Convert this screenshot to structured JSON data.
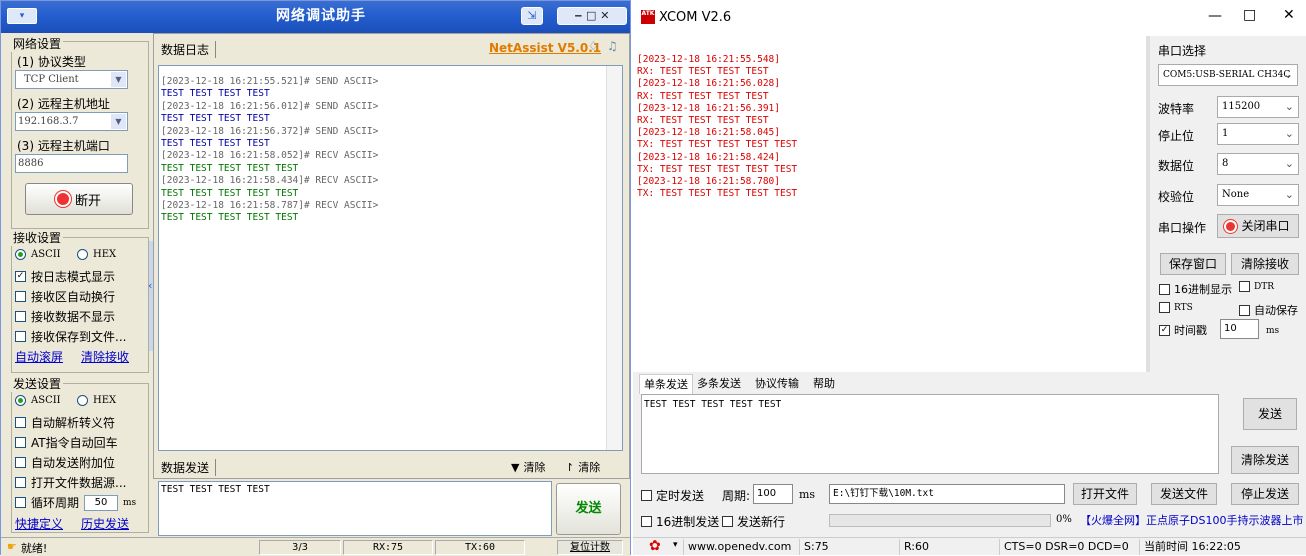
{
  "left": {
    "title": "网络调试助手",
    "net": {
      "header": "网络设置",
      "proto_label": "(1) 协议类型",
      "proto_value": "TCP Client",
      "host_label": "(2) 远程主机地址",
      "host_value": "192.168.3.7",
      "port_label": "(3) 远程主机端口",
      "port_value": "8886",
      "disconnect": "断开"
    },
    "recv": {
      "header": "接收设置",
      "ascii": "ASCII",
      "hex": "HEX",
      "opts": [
        "按日志模式显示",
        "接收区自动换行",
        "接收数据不显示",
        "接收保存到文件..."
      ],
      "opts_checked": [
        true,
        false,
        false,
        false
      ],
      "auto_clear": "自动滚屏",
      "clear_recv": "清除接收"
    },
    "send": {
      "header": "发送设置",
      "ascii": "ASCII",
      "hex": "HEX",
      "opts": [
        "自动解析转义符",
        "AT指令自动回车",
        "自动发送附加位",
        "打开文件数据源..."
      ],
      "cycle_label": "循环周期",
      "cycle_value": "50",
      "cycle_unit": "ms",
      "shortcut": "快捷定义",
      "history": "历史发送"
    },
    "log_label": "数据日志",
    "brand": "NetAssist V5.0.1",
    "log": [
      {
        "t": "[2023-12-18 16:21:55.521]# SEND ASCII>",
        "c": "gray"
      },
      {
        "t": "TEST TEST TEST TEST",
        "c": "blue"
      },
      {
        "t": "[2023-12-18 16:21:56.012]# SEND ASCII>",
        "c": "gray"
      },
      {
        "t": "TEST TEST TEST TEST",
        "c": "blue"
      },
      {
        "t": "[2023-12-18 16:21:56.372]# SEND ASCII>",
        "c": "gray"
      },
      {
        "t": "TEST TEST TEST TEST",
        "c": "blue"
      },
      {
        "t": "[2023-12-18 16:21:58.052]# RECV ASCII>",
        "c": "gray"
      },
      {
        "t": "TEST TEST TEST TEST TEST",
        "c": "green"
      },
      {
        "t": "[2023-12-18 16:21:58.434]# RECV ASCII>",
        "c": "gray"
      },
      {
        "t": "TEST TEST TEST TEST TEST",
        "c": "green"
      },
      {
        "t": "[2023-12-18 16:21:58.787]# RECV ASCII>",
        "c": "gray"
      },
      {
        "t": "TEST TEST TEST TEST TEST",
        "c": "green"
      }
    ],
    "send_label": "数据发送",
    "clear1": "清除",
    "clear2": "清除",
    "send_text": "TEST TEST TEST TEST",
    "send_btn": "发送",
    "status": {
      "ready": "就绪!",
      "count": "3/3",
      "rx": "RX:75",
      "tx": "TX:60",
      "reset": "复位计数"
    }
  },
  "right": {
    "title": "XCOM V2.6",
    "log": [
      "[2023-12-18 16:21:55.548]",
      "RX: TEST TEST TEST TEST",
      "[2023-12-18 16:21:56.028]",
      "RX: TEST TEST TEST TEST",
      "[2023-12-18 16:21:56.391]",
      "RX: TEST TEST TEST TEST",
      "[2023-12-18 16:21:58.045]",
      "TX: TEST TEST TEST TEST TEST",
      "[2023-12-18 16:21:58.424]",
      "TX: TEST TEST TEST TEST TEST",
      "[2023-12-18 16:21:58.780]",
      "TX: TEST TEST TEST TEST TEST"
    ],
    "port_label": "串口选择",
    "port_value": "COM5:USB-SERIAL CH34C",
    "baud_label": "波特率",
    "baud_value": "115200",
    "stop_label": "停止位",
    "stop_value": "1",
    "data_label": "数据位",
    "data_value": "8",
    "parity_label": "校验位",
    "parity_value": "None",
    "op_label": "串口操作",
    "op_btn": "关闭串口",
    "save_win": "保存窗口",
    "clear_recv": "清除接收",
    "hex_show": "16进制显示",
    "dtr": "DTR",
    "rts": "RTS",
    "autosave": "自动保存",
    "timestamp": "时间戳",
    "ts_value": "10",
    "ts_unit": "ms",
    "tabs": [
      "单条发送",
      "多条发送",
      "协议传输",
      "帮助"
    ],
    "tx_text": "TEST TEST TEST TEST TEST",
    "send_btn": "发送",
    "clear_send": "清除发送",
    "timed_send": "定时发送",
    "period_label": "周期:",
    "period_value": "100",
    "period_unit": "ms",
    "file_path": "E:\\钉钉下载\\10M.txt",
    "open_file": "打开文件",
    "send_file": "发送文件",
    "stop_send": "停止发送",
    "hex_send": "16进制发送",
    "send_newline": "发送新行",
    "progress": "0%",
    "ad": "【火爆全网】正点原子DS100手持示波器上市",
    "status": {
      "url": "www.openedv.com",
      "s": "S:75",
      "r": "R:60",
      "lines": "CTS=0 DSR=0 DCD=0",
      "time": "当前时间 16:22:05"
    }
  }
}
